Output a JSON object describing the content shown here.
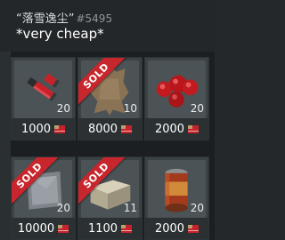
{
  "listing": {
    "seller_name": "“落雪逸尘”",
    "seller_id": "#5495",
    "note": "*very cheap*"
  },
  "items": [
    {
      "name": "Flare Gun Shells",
      "icon": "flare-shell-icon",
      "quantity": "20",
      "price": "1000",
      "sold": false
    },
    {
      "name": "Animal Hide",
      "icon": "hide-icon",
      "quantity": "10",
      "price": "8000",
      "sold": true
    },
    {
      "name": "Wild Berries",
      "icon": "berries-icon",
      "quantity": "20",
      "price": "2000",
      "sold": false
    },
    {
      "name": "Metal Plate",
      "icon": "metal-plate-icon",
      "quantity": "20",
      "price": "10000",
      "sold": true
    },
    {
      "name": "Stone Block",
      "icon": "stone-block-icon",
      "quantity": "11",
      "price": "1100",
      "sold": true
    },
    {
      "name": "Canned Food",
      "icon": "tin-can-icon",
      "quantity": "20",
      "price": "2000",
      "sold": false
    }
  ],
  "labels": {
    "sold": "SOLD"
  },
  "colors": {
    "sold_ribbon": "#c8262d",
    "tile_bg": "#3b4244",
    "text": "#ffffff"
  },
  "currency_icon": "flag-currency-icon"
}
